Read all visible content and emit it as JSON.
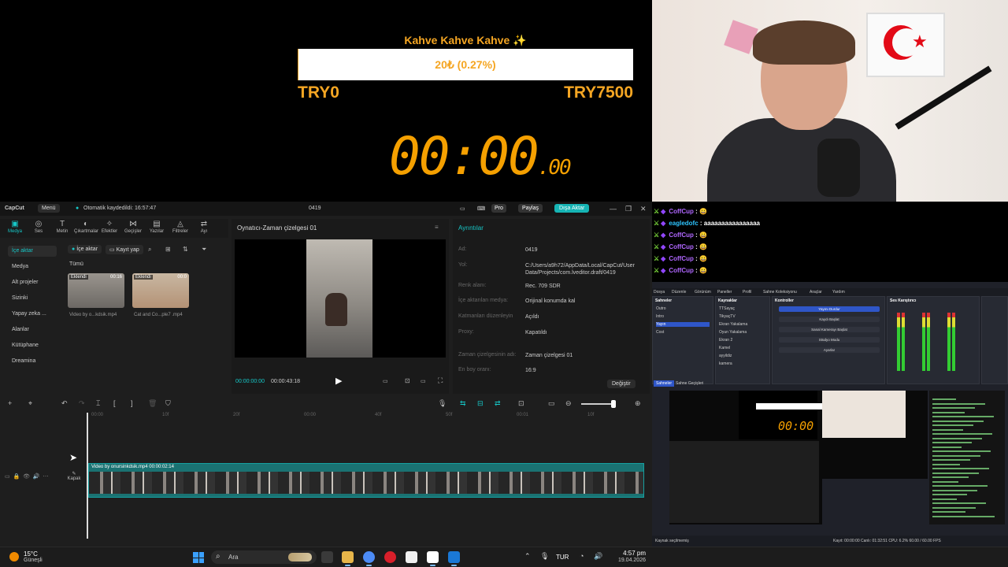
{
  "overlay": {
    "goal_title": "Kahve Kahve Kahve ✨",
    "goal_progress_text": "20₺ (0.27%)",
    "goal_fraction": 0.0027,
    "goal_min": "TRY0",
    "goal_max": "TRY7500",
    "timer_main": "00:00",
    "timer_ms": ".00"
  },
  "capcut": {
    "app_name": "CapCut",
    "menu_label": "Menü",
    "autosave": "Otomatik kaydedildi: 16:57:47",
    "project_name": "0419",
    "pro_label": "Pro",
    "share_label": "Paylaş",
    "export_label": "Dışa Aktar",
    "toolbar": [
      {
        "icon": "▣",
        "label": "Medya"
      },
      {
        "icon": "◎",
        "label": "Ses"
      },
      {
        "icon": "T",
        "label": "Metin"
      },
      {
        "icon": "◐",
        "label": "Çıkartmalar"
      },
      {
        "icon": "✧",
        "label": "Efektler"
      },
      {
        "icon": "⋈",
        "label": "Geçişler"
      },
      {
        "icon": "▤",
        "label": "Yazılar"
      },
      {
        "icon": "◬",
        "label": "Filtreler"
      },
      {
        "icon": "⇄",
        "label": "Ayı"
      }
    ],
    "sidebar": [
      {
        "label": "İçe aktar",
        "selected": true
      },
      {
        "label": "Medya"
      },
      {
        "label": "Alt projeler"
      },
      {
        "label": "Sizinki"
      },
      {
        "label": "Yapay zeka ..."
      },
      {
        "label": "Alanlar"
      },
      {
        "label": "Kütüphane"
      },
      {
        "label": "Dreamina"
      }
    ],
    "import_btn": "İçe aktar",
    "record_btn": "Kayıt yap",
    "filter_all": "Tümü",
    "media": [
      {
        "badge": "Eklendi",
        "duration": "00:16",
        "name": "Video by o...kdsik.mp4"
      },
      {
        "badge": "Eklendi",
        "duration": "00:0",
        "name": "Cat and Co...ple7 .mp4"
      }
    ],
    "player_title": "Oynatıcı-Zaman çizelgesi 01",
    "player_time": "00:00:00:00",
    "player_total": "00:00:43:18",
    "details_title": "Ayrıntılar",
    "details": [
      {
        "label": "Ad:",
        "value": "0419"
      },
      {
        "label": "Yol:",
        "value": "C:/Users/a9h72/AppData/Local/CapCut/User Data/Projects/com.lveditor.draft/0419"
      },
      {
        "label": "Renk alanı:",
        "value": "Rec. 709 SDR"
      },
      {
        "label": "İçe aktarılan medya:",
        "value": "Orijinal konumda kal"
      },
      {
        "label": "Katmanları düzenleyin",
        "value": "Açıldı"
      },
      {
        "label": "Proxy:",
        "value": "Kapatıldı"
      },
      {
        "label": "Zaman çizelgesinin adı:",
        "value": "Zaman çizelgesi 01"
      },
      {
        "label": "En boy oranı:",
        "value": "16:9"
      }
    ],
    "change_btn": "Değiştir",
    "ruler": [
      "00:00",
      "10f",
      "20f",
      "00:00",
      "40f",
      "50f",
      "00:01",
      "10f"
    ],
    "clip_label": "Video by onursinkdsik.mp4  00:00:02:14",
    "cover_label": "Kapak"
  },
  "chat": [
    {
      "user": "CoffCup",
      "msg": ": 😀",
      "color": "#b067ff"
    },
    {
      "user": "eagledofc",
      "msg": ": aaaaaaaaaaaaaaaa",
      "color": "#2ec4ff"
    },
    {
      "user": "CoffCup",
      "msg": ": 😀",
      "color": "#b067ff"
    },
    {
      "user": "CoffCup",
      "msg": ": 😀",
      "color": "#b067ff"
    },
    {
      "user": "CoffCup",
      "msg": ": 😀",
      "color": "#b067ff"
    },
    {
      "user": "CoffCup",
      "msg": ": 😀",
      "color": "#b067ff"
    }
  ],
  "obs": {
    "menu": [
      "Dosya",
      "Düzenle",
      "Görünüm",
      "Paneller",
      "Profil",
      "Sahne Koleksiyonu",
      "Araçlar",
      "Yardım"
    ],
    "scenes_title": "Sahneler",
    "scenes": [
      "Outro",
      "Intro",
      "Yayın",
      "Cost"
    ],
    "sources_title": "Kaynaklar",
    "sources": [
      "TTSayaç",
      "TikyaçTV",
      "Ekran Yakalama",
      "Oyun Yakalama",
      "Ekran 2",
      "Kamel",
      "ayyildiz",
      "kamera"
    ],
    "controls_title": "Kontroller",
    "controls": [
      "Yayını Durdur",
      "Kaydı Başlat",
      "Sanal Kamerayı Başlat",
      "Stüdyo Modu",
      "Ayarlar"
    ],
    "mixer_title": "Ses Karıştırıcı",
    "tab_scenes": "Sahneler",
    "tab_transitions": "Sahne Geçişleri",
    "status_left": "Kaynak seçilmemiş",
    "status_right": "Kayıt: 00:00:00   Canlı: 01:32:51   CPU: 6.2%   60.00 / 60.00 FPS"
  },
  "taskbar": {
    "temp": "15°C",
    "weather": "Güneşli",
    "search": "Ara",
    "lang": "TUR",
    "time": "4:57 pm",
    "date": "19.04.2026"
  }
}
